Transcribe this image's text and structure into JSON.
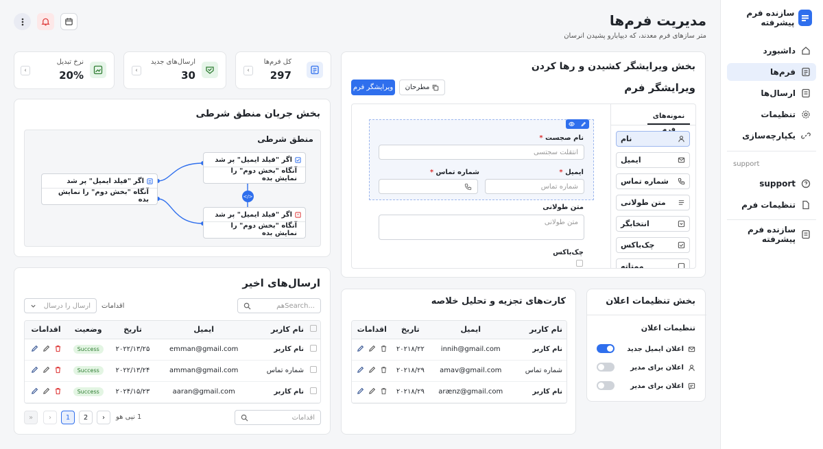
{
  "sidebar": {
    "brand": "سازنده فرم پیشرفته",
    "items": [
      {
        "label": "داشبورد"
      },
      {
        "label": "فرم‌ها"
      },
      {
        "label": "ارسال‌ها"
      },
      {
        "label": "تنظیمات"
      },
      {
        "label": "یکپارچه‌سازی"
      }
    ],
    "section_caption": "support",
    "support_items": [
      {
        "label": "support"
      },
      {
        "label": "تنظیمات فرم"
      }
    ],
    "footer_item": "سازنده فرم پیشرفته"
  },
  "header": {
    "title": "مدیریت فرم‌ها",
    "subtitle": "متر سازهای فرم معدند، که دیپابارو پشیدن انرسان"
  },
  "stats": [
    {
      "label": "کل فرم‌ها",
      "value": "297"
    },
    {
      "label": "ارسال‌های جدید",
      "value": "30"
    },
    {
      "label": "نرخ تبدیل",
      "value": "20%"
    }
  ],
  "builder": {
    "section_title": "بخش ویرایشگر کشیدن و رها کردن",
    "title": "ویرایشگر فرم",
    "templates_btn": "مطرحان",
    "editor_btn": "ویرایشگر فرم",
    "palette_tab": "نمونه‌های فرم",
    "palette": [
      {
        "label": "نام",
        "icon": "user-icon"
      },
      {
        "label": "ایمیل",
        "icon": "mail-icon"
      },
      {
        "label": "شماره تماس",
        "icon": "phone-icon"
      },
      {
        "label": "متن طولانی",
        "icon": "lines-icon"
      },
      {
        "label": "انتخابگر",
        "icon": "select-icon"
      },
      {
        "label": "چک‌باکس",
        "icon": "checkbox-icon"
      },
      {
        "label": "ممتاته",
        "icon": "checkbox-icon"
      }
    ],
    "fields": {
      "name_label": "نام صجست",
      "name_placeholder": "انتقلت سجتسی",
      "email_label": "ایمیل",
      "email_placeholder": "شماره تماس",
      "phone_label": "شماره تماس",
      "longtext_label": "متن طولانی",
      "longtext_placeholder": "متن طولانی",
      "checkbox_label": "چک‌باکس"
    }
  },
  "logic": {
    "section_title": "بخش جریان منطق شرطی",
    "panel_title": "منطق شرطی",
    "rules": [
      {
        "if": "اگر \"فیلد ایمیل\" پر شد",
        "then": "آنگاه \"بخش دوم\" را نمایش بده"
      },
      {
        "if": "اگر \"فیلد ایمیل\" پر شد",
        "then": "آنگاه \"بخش دوم\" را نمایش بده"
      },
      {
        "if": "اگر \"فیلد ایمیل\" پر شد",
        "then": "آنگاه \"بخش دوم\" را نمایش بده"
      }
    ]
  },
  "submissions": {
    "title": "ارسال‌های اخیر",
    "search_placeholder": "...Searchهم",
    "actions_label": "اقدامات",
    "filter_placeholder": "ارسال را درسال",
    "columns": [
      "نام کاربر",
      "ایمیل",
      "تاریخ",
      "وضعیت",
      "اقدامات"
    ],
    "rows": [
      {
        "user": "نام کاربر",
        "email": "emman@gmail.com",
        "date": "۲۰۲۲/۱۳/۲۵",
        "status": "Success"
      },
      {
        "user": "شماره تماس",
        "email": "amman@gmail.com",
        "date": "۲۰۲۲/۱۳/۲۴",
        "status": "Success"
      },
      {
        "user": "نام کاربر",
        "email": "aaran@gmail.com",
        "date": "۲۰۲۴/۱۵/۲۳",
        "status": "Success"
      }
    ],
    "pagination_text": "1 نیی هو",
    "pages": [
      "1",
      "2"
    ],
    "footer_search": "اقدامات"
  },
  "analytics": {
    "title": "کارت‌های تجزیه و تحلیل خلاصه",
    "columns": [
      "نام کاربر",
      "ایمیل",
      "تاریخ",
      "اقدامات"
    ],
    "rows": [
      {
        "user": "نام کاربر",
        "email": "innih@gmail.com",
        "date": "۲۰۲۱۸/۲۲"
      },
      {
        "user": "شماره تماس",
        "email": "amav@gmail.com",
        "date": "۲۰۲۱۸/۲۹"
      },
      {
        "user": "نام کاربر",
        "email": "arænz@gmail.com",
        "date": "۲۰۲۱۸/۲۹"
      }
    ]
  },
  "notifications": {
    "section_title": "بخش تنظیمات اعلان",
    "panel_title": "تنظیمات اعلان",
    "items": [
      {
        "label": "اعلان ایمیل جدید",
        "on": true
      },
      {
        "label": "اعلان برای مدیر",
        "on": false
      },
      {
        "label": "اعلان برای مدیر",
        "on": false
      }
    ]
  },
  "colors": {
    "accent": "#2f6fed",
    "success": "#2f7d32",
    "danger": "#d33333"
  }
}
